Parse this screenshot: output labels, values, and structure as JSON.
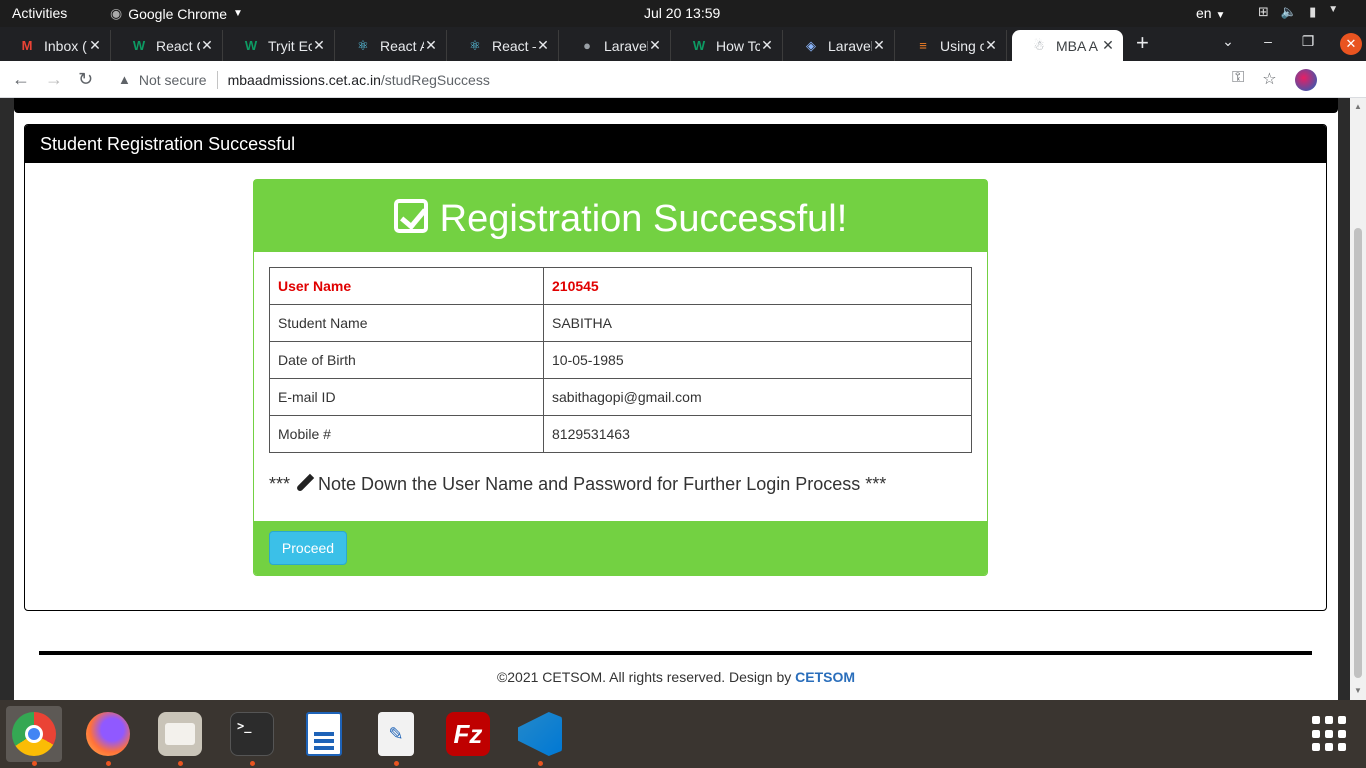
{
  "topbar": {
    "activities": "Activities",
    "app_name": "Google Chrome",
    "clock": "Jul 20  13:59",
    "language": "en"
  },
  "tabs": [
    {
      "favicon": "M",
      "favicon_color": "#ea4335",
      "title": "Inbox ("
    },
    {
      "favicon": "W",
      "favicon_color": "#0d9b63",
      "title": "React C"
    },
    {
      "favicon": "W",
      "favicon_color": "#0d9b63",
      "title": "Tryit Ec"
    },
    {
      "favicon": "⚛",
      "favicon_color": "#61dafb",
      "title": "React A"
    },
    {
      "favicon": "⚛",
      "favicon_color": "#61dafb",
      "title": "React –"
    },
    {
      "favicon": "●",
      "favicon_color": "#9aa0a6",
      "title": "Laravel"
    },
    {
      "favicon": "W",
      "favicon_color": "#0d9b63",
      "title": "How Tc"
    },
    {
      "favicon": "◈",
      "favicon_color": "#8ab4f8",
      "title": "Laravel"
    },
    {
      "favicon": "≡",
      "favicon_color": "#f48024",
      "title": "Using c"
    },
    {
      "favicon": "☃",
      "favicon_color": "#9aa0a6",
      "title": "MBA A"
    }
  ],
  "address_bar": {
    "security_label": "Not secure",
    "host": "mbaadmissions.cet.ac.in",
    "path": "/studRegSuccess"
  },
  "panel": {
    "heading": "Student Registration Successful"
  },
  "success": {
    "title": "Registration Successful!",
    "rows": [
      {
        "label": "User Name",
        "value": "210545"
      },
      {
        "label": "Student Name",
        "value": "SABITHA"
      },
      {
        "label": "Date of Birth",
        "value": "10-05-1985"
      },
      {
        "label": "E-mail ID",
        "value": "sabithagopi@gmail.com"
      },
      {
        "label": "Mobile #",
        "value": "8129531463"
      }
    ],
    "note_prefix": "***",
    "note_text": "Note Down the User Name and Password for Further Login Process ***",
    "proceed_label": "Proceed"
  },
  "footer": {
    "copyright": "©2021 CETSOM. All rights reserved. Design by",
    "brand": "CETSOM"
  },
  "colors": {
    "success_green": "#73d142",
    "highlight_red": "#e00000",
    "button_blue": "#3bc0e8",
    "brand_link": "#2a6ebb"
  },
  "dock": [
    {
      "name": "chrome-icon",
      "color": "#4285f4"
    },
    {
      "name": "firefox-icon",
      "color": "#ff7139"
    },
    {
      "name": "files-icon",
      "color": "#c9c4b8"
    },
    {
      "name": "terminal-icon",
      "color": "#2c2c2c"
    },
    {
      "name": "document-viewer-icon",
      "color": "#1e63b8"
    },
    {
      "name": "text-editor-icon",
      "color": "#f2f2f2"
    },
    {
      "name": "filezilla-icon",
      "color": "#bf0000"
    },
    {
      "name": "vscode-icon",
      "color": "#0078d4"
    }
  ]
}
